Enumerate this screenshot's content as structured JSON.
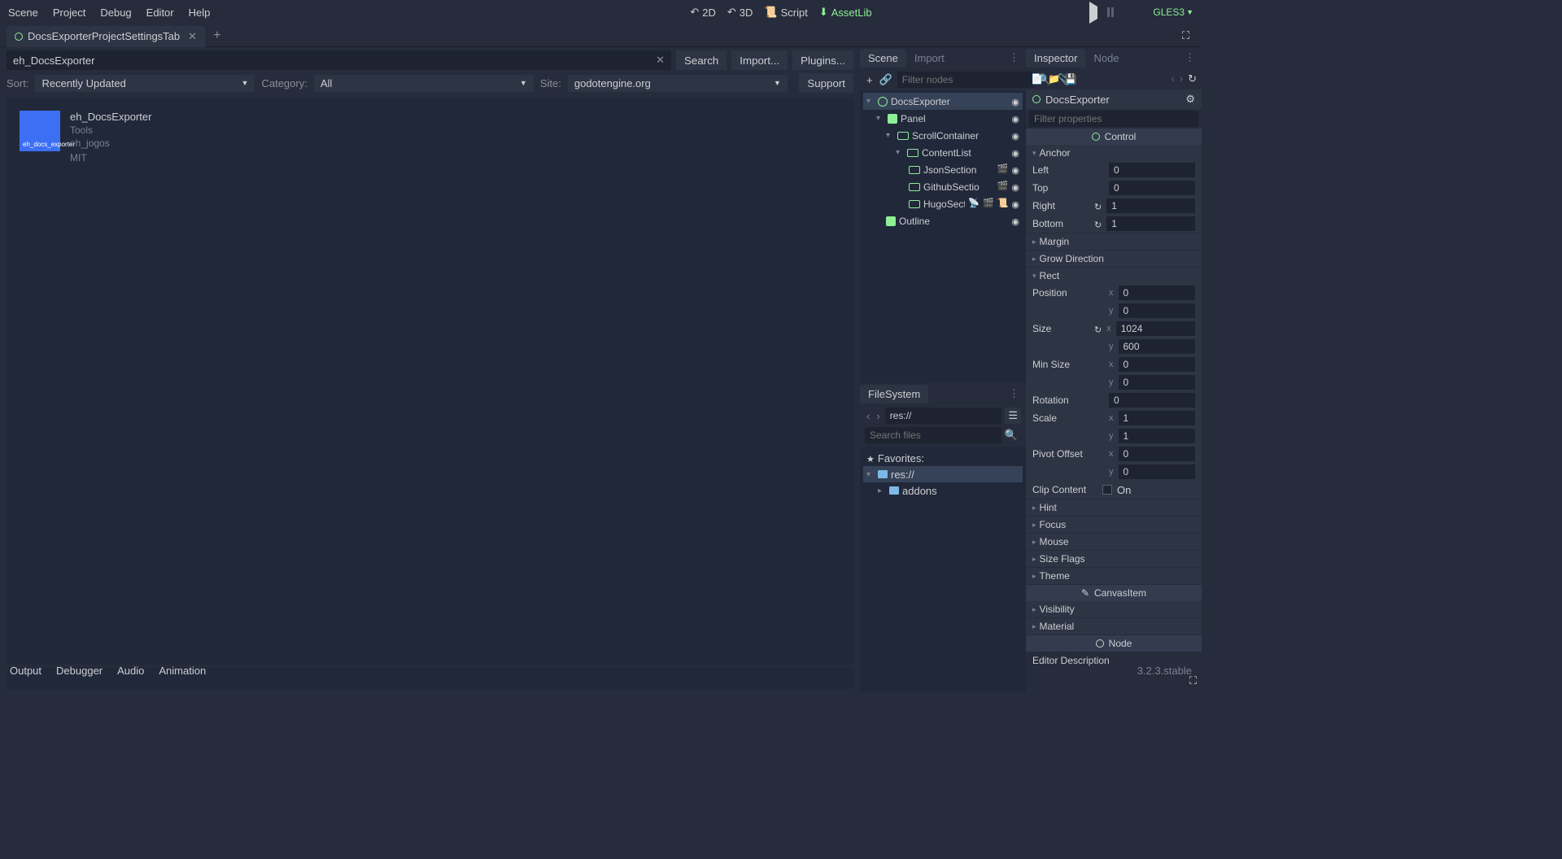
{
  "menu": {
    "scene": "Scene",
    "project": "Project",
    "debug": "Debug",
    "editor": "Editor",
    "help": "Help"
  },
  "workspace": {
    "2d": "2D",
    "3d": "3D",
    "script": "Script",
    "assetlib": "AssetLib"
  },
  "renderer": "GLES3",
  "tabs": {
    "main": "DocsExporterProjectSettingsTab"
  },
  "assetlib": {
    "search_value": "eh_DocsExporter",
    "search_btn": "Search",
    "import_btn": "Import...",
    "plugins_btn": "Plugins...",
    "sort_label": "Sort:",
    "sort_value": "Recently Updated",
    "category_label": "Category:",
    "category_value": "All",
    "site_label": "Site:",
    "site_value": "godotengine.org",
    "support_btn": "Support",
    "asset": {
      "name": "eh_DocsExporter",
      "category": "Tools",
      "author": "eh_jogos",
      "license": "MIT",
      "icon_text": "eh_docs_exporter"
    }
  },
  "scene_dock": {
    "tab_scene": "Scene",
    "tab_import": "Import",
    "filter_placeholder": "Filter nodes",
    "tree": {
      "root": "DocsExporter",
      "panel": "Panel",
      "scroll": "ScrollContainer",
      "content": "ContentList",
      "json": "JsonSection",
      "github": "GithubSectio",
      "hugo": "HugoSect",
      "outline": "Outline"
    }
  },
  "filesystem": {
    "title": "FileSystem",
    "path": "res://",
    "search_placeholder": "Search files",
    "favorites": "Favorites:",
    "res": "res://",
    "addons": "addons"
  },
  "inspector": {
    "tab_inspector": "Inspector",
    "tab_node": "Node",
    "object": "DocsExporter",
    "filter_placeholder": "Filter properties",
    "control_header": "Control",
    "groups": {
      "anchor": "Anchor",
      "margin": "Margin",
      "grow": "Grow Direction",
      "rect": "Rect",
      "hint": "Hint",
      "focus": "Focus",
      "mouse": "Mouse",
      "sizeflags": "Size Flags",
      "theme": "Theme",
      "visibility": "Visibility",
      "material": "Material"
    },
    "canvasitem_header": "CanvasItem",
    "node_header": "Node",
    "editor_description": "Editor Description",
    "props": {
      "left": "Left",
      "left_v": "0",
      "top": "Top",
      "top_v": "0",
      "right": "Right",
      "right_v": "1",
      "bottom": "Bottom",
      "bottom_v": "1",
      "position": "Position",
      "pos_x": "0",
      "pos_y": "0",
      "size": "Size",
      "size_x": "1024",
      "size_y": "600",
      "minsize": "Min Size",
      "min_x": "0",
      "min_y": "0",
      "rotation": "Rotation",
      "rot_v": "0",
      "scale": "Scale",
      "scale_x": "1",
      "scale_y": "1",
      "pivot": "Pivot Offset",
      "piv_x": "0",
      "piv_y": "0",
      "clip": "Clip Content",
      "clip_v": "On"
    }
  },
  "bottom": {
    "output": "Output",
    "debugger": "Debugger",
    "audio": "Audio",
    "animation": "Animation",
    "version": "3.2.3.stable"
  }
}
